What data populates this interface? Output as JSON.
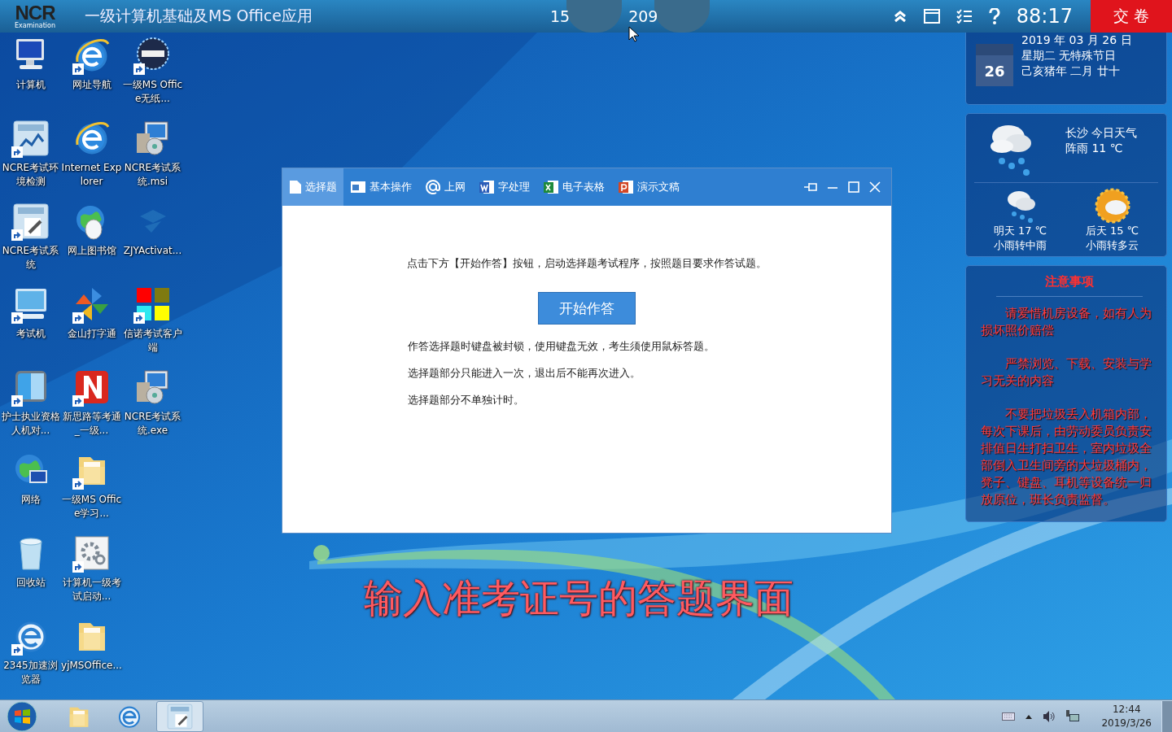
{
  "top_bar": {
    "logo": "NCR",
    "logo_sub": "Examination",
    "title": "一级计算机基础及MS Office应用",
    "candidate_fields": [
      "15",
      "209"
    ],
    "timer": "88:17",
    "submit_button": "交 卷"
  },
  "desktop_icons": [
    {
      "label": "计算机",
      "kind": "computer",
      "shortcut": false
    },
    {
      "label": "NCRE考试环境检测",
      "kind": "ncre-chart",
      "shortcut": true
    },
    {
      "label": "NCRE考试系统",
      "kind": "ncre-doc",
      "shortcut": true
    },
    {
      "label": "考试机",
      "kind": "monitor",
      "shortcut": true
    },
    {
      "label": "护士执业资格人机对...",
      "kind": "finder",
      "shortcut": true
    },
    {
      "label": "网络",
      "kind": "network",
      "shortcut": false
    },
    {
      "label": "回收站",
      "kind": "recycle",
      "shortcut": false
    },
    {
      "label": "2345加速浏览器",
      "kind": "round-e",
      "shortcut": true
    },
    {
      "label": "网址导航",
      "kind": "ie",
      "shortcut": true
    },
    {
      "label": "Internet Explorer",
      "kind": "ie",
      "shortcut": false
    },
    {
      "label": "网上图书馆",
      "kind": "globe-mouse",
      "shortcut": false
    },
    {
      "label": "金山打字通",
      "kind": "pinwheel",
      "shortcut": true
    },
    {
      "label": "新思路等考通_一级...",
      "kind": "red-n",
      "shortcut": true
    },
    {
      "label": "一级MS Office学习...",
      "kind": "folder",
      "shortcut": true
    },
    {
      "label": "计算机一级考试启动...",
      "kind": "gear-window",
      "shortcut": true
    },
    {
      "label": "yjMSOffice...",
      "kind": "folder",
      "shortcut": false
    },
    {
      "label": "一级MS Office无纸...",
      "kind": "badge",
      "shortcut": true
    },
    {
      "label": "NCRE考试系统.msi",
      "kind": "installer",
      "shortcut": false
    },
    {
      "label": "ZJYActivat...",
      "kind": "faded",
      "shortcut": false
    },
    {
      "label": "信诺考试客户端",
      "kind": "squares",
      "shortcut": true
    },
    {
      "label": "NCRE考试系统.exe",
      "kind": "installer",
      "shortcut": false
    }
  ],
  "dialog": {
    "tabs": [
      {
        "label": "选择题",
        "kind": "doc",
        "selected": true
      },
      {
        "label": "基本操作",
        "kind": "window",
        "selected": false
      },
      {
        "label": "上网",
        "kind": "at",
        "selected": false
      },
      {
        "label": "字处理",
        "kind": "word",
        "selected": false
      },
      {
        "label": "电子表格",
        "kind": "excel",
        "selected": false
      },
      {
        "label": "演示文稿",
        "kind": "ppt",
        "selected": false
      }
    ],
    "instruction": "点击下方【开始作答】按钮，启动选择题考试程序，按照题目要求作答试题。",
    "start_button": "开始作答",
    "notes": [
      "作答选择题时键盘被封锁，使用键盘无效，考生须使用鼠标答题。",
      "选择题部分只能进入一次，退出后不能再次进入。",
      "选择题部分不单独计时。"
    ]
  },
  "calendar": {
    "day": "26",
    "lines": [
      "2019 年 03 月 26 日",
      "星期二  无特殊节日",
      "己亥猪年 二月 廿十"
    ]
  },
  "weather": {
    "today": [
      "长沙 今日天气",
      "阵雨 11 ℃"
    ],
    "forecast": [
      {
        "lines": [
          "明天 17 ℃",
          "小雨转中雨"
        ],
        "kind": "rain"
      },
      {
        "lines": [
          "后天 15 ℃",
          "小雨转多云"
        ],
        "kind": "sun-cloud"
      }
    ]
  },
  "notice": {
    "title": "注意事项",
    "paragraphs": [
      "请爱惜机房设备，如有人为损坏照价赔偿",
      "严禁浏览、下载、安装与学习无关的内容",
      "不要把垃圾丢入机箱内部，每次下课后，由劳动委员负责安排值日生打扫卫生，室内垃圾全部倒入卫生间旁的大垃圾桶内，凳子、键盘、耳机等设备统一归放原位，班长负责监督。"
    ]
  },
  "caption": "输入准考证号的答题界面",
  "taskbar": {
    "apps": [
      {
        "kind": "folder",
        "selected": false
      },
      {
        "kind": "round-e",
        "selected": false
      },
      {
        "kind": "ncre-doc",
        "selected": true
      }
    ],
    "time": "12:44",
    "date": "2019/3/26"
  }
}
